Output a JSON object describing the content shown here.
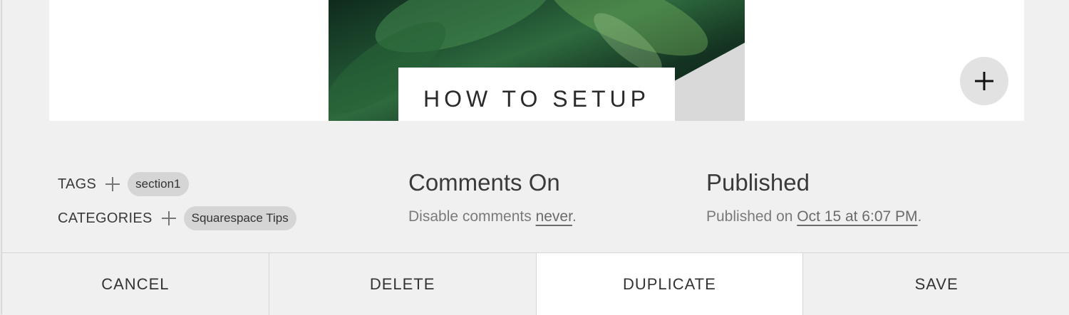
{
  "editor": {
    "image_title": "HOW TO SETUP",
    "add_block_icon": "plus-icon"
  },
  "meta": {
    "tags_label": "TAGS",
    "tags": [
      "section1"
    ],
    "categories_label": "CATEGORIES",
    "categories": [
      "Squarespace Tips"
    ]
  },
  "comments": {
    "title": "Comments On",
    "sub_prefix": "Disable comments ",
    "sub_link": "never",
    "sub_suffix": "."
  },
  "publish": {
    "title": "Published",
    "sub_prefix": "Published on ",
    "sub_link": "Oct 15 at 6:07 PM",
    "sub_suffix": "."
  },
  "footer": {
    "cancel": "CANCEL",
    "delete": "DELETE",
    "duplicate": "DUPLICATE",
    "save": "SAVE"
  },
  "colors": {
    "panel_bg": "#f0f0f0",
    "pill_bg": "#d5d5d5",
    "active_button_bg": "#ffffff"
  }
}
